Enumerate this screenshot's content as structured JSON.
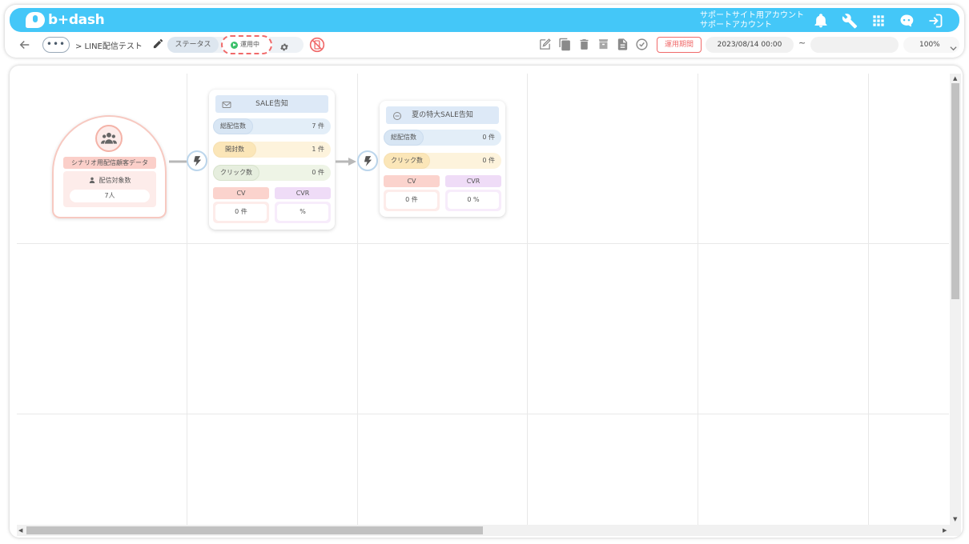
{
  "app": {
    "logo_text": "b+dash",
    "account_line1": "サポートサイト用アカウント",
    "account_line2": "サポートアカウント"
  },
  "header_icons": [
    "bell-icon",
    "wrench-icon",
    "grid-icon",
    "robot-icon",
    "logout-icon"
  ],
  "toolbar": {
    "more_label": "•••",
    "breadcrumb": "> LINE配信テスト",
    "status_label": "ステータス",
    "status_value": "運用中",
    "period_button": "運用期間",
    "start_date": "2023/08/14 00:00",
    "date_separator": "~",
    "end_date": "",
    "zoom": "100%"
  },
  "colors": {
    "header": "#44c7f8",
    "accent_red": "#f06a6a",
    "active_green": "#3cc06a"
  },
  "start_node": {
    "title": "シナリオ用配信顧客データ",
    "sub_label": "配信対象数",
    "count": "7人"
  },
  "nodes": [
    {
      "title": "SALE告知",
      "total_label": "総配信数",
      "total_value": "7 件",
      "open_label": "開封数",
      "open_value": "1 件",
      "click_label": "クリック数",
      "click_value": "0 件",
      "cv_label": "CV",
      "cv_value": "0 件",
      "cvr_label": "CVR",
      "cvr_value": "%"
    },
    {
      "title": "夏の特大SALE告知",
      "total_label": "総配信数",
      "total_value": "0 件",
      "click_label": "クリック数",
      "click_value": "0 件",
      "cv_label": "CV",
      "cv_value": "0 件",
      "cvr_label": "CVR",
      "cvr_value": "0 %"
    }
  ]
}
